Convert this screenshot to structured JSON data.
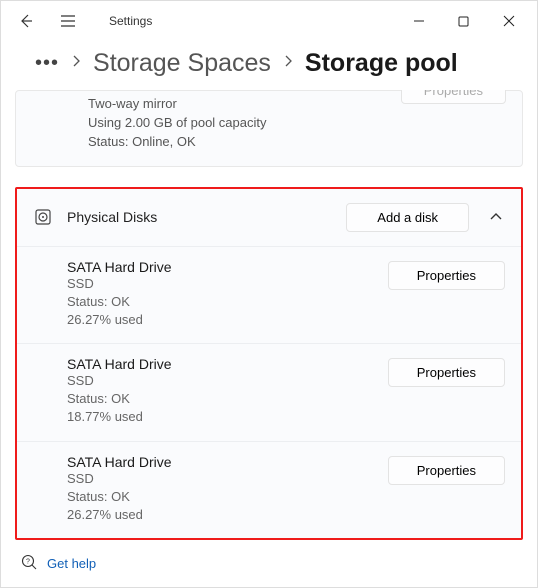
{
  "titlebar": {
    "title": "Settings"
  },
  "breadcrumb": {
    "prev": "Storage Spaces",
    "current": "Storage pool"
  },
  "partial_card": {
    "line1": "Two-way mirror",
    "line2": "Using 2.00 GB of pool capacity",
    "line3": "Status: Online, OK",
    "button": "Properties"
  },
  "section": {
    "title": "Physical Disks",
    "action": "Add a disk"
  },
  "disks": [
    {
      "name": "SATA Hard Drive",
      "type": "SSD",
      "status": "Status: OK",
      "used": "26.27% used",
      "button": "Properties"
    },
    {
      "name": "SATA Hard Drive",
      "type": "SSD",
      "status": "Status: OK",
      "used": "18.77% used",
      "button": "Properties"
    },
    {
      "name": "SATA Hard Drive",
      "type": "SSD",
      "status": "Status: OK",
      "used": "26.27% used",
      "button": "Properties"
    }
  ],
  "footer": {
    "help": "Get help"
  }
}
